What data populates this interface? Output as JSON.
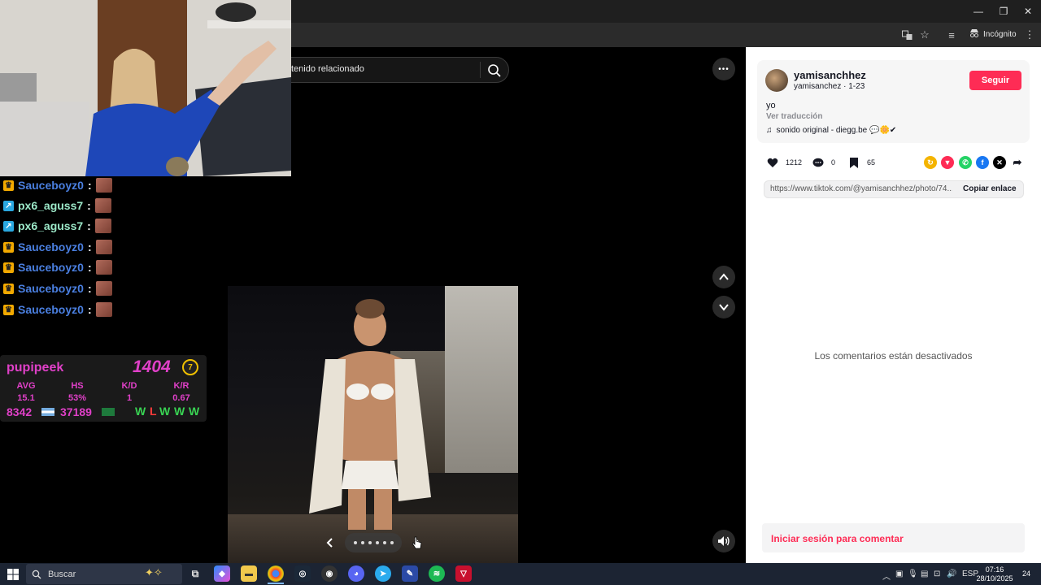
{
  "browser": {
    "incognito_label": "Incógnito",
    "icons": [
      "translate-icon",
      "bookmark-star-icon",
      "reading-list-icon",
      "incognito-icon",
      "browser-menu-icon"
    ],
    "window_controls": [
      "minimize-icon",
      "restore-icon",
      "close-icon"
    ]
  },
  "video": {
    "search_text": "tenido relacionado",
    "more_label": "•••",
    "carousel_dots": 6
  },
  "chat": {
    "lines": [
      {
        "user": "Sauceboyz0",
        "badge": "crown",
        "color": "#4a7fe0"
      },
      {
        "user": "px6_aguss7",
        "badge": "arrow",
        "color": "#9ce8c8"
      },
      {
        "user": "px6_aguss7",
        "badge": "arrow",
        "color": "#9ce8c8"
      },
      {
        "user": "Sauceboyz0",
        "badge": "crown",
        "color": "#4a7fe0"
      },
      {
        "user": "Sauceboyz0",
        "badge": "crown",
        "color": "#4a7fe0"
      },
      {
        "user": "Sauceboyz0",
        "badge": "crown",
        "color": "#4a7fe0"
      },
      {
        "user": "Sauceboyz0",
        "badge": "crown",
        "color": "#4a7fe0"
      }
    ],
    "colon": ":"
  },
  "stats": {
    "name": "pupipeek",
    "elo": "1404",
    "level": "7",
    "headers": [
      "AVG",
      "HS",
      "K/D",
      "K/R"
    ],
    "values": [
      "15.1",
      "53%",
      "1",
      "0.67"
    ],
    "rank_ar": "8342",
    "rank_sa": "37189",
    "results": [
      "W",
      "L",
      "W",
      "W",
      "W"
    ]
  },
  "post": {
    "username": "yamisanchhez",
    "subline": "yamisanchez · 1-23",
    "follow_label": "Seguir",
    "caption": "yo",
    "translate_label": "Ver traducción",
    "sound": "sonido original - diegg.be 💬🌼✔",
    "likes": "1212",
    "comments": "0",
    "saves": "65",
    "link": "https://www.tiktok.com/@yamisanchhez/photo/74...",
    "copy_label": "Copiar enlace",
    "comments_disabled": "Los comentarios están desactivados",
    "login_prompt": "Iniciar sesión para comentar"
  },
  "taskbar": {
    "search_placeholder": "Buscar",
    "tray_lang": "ESP",
    "time": "07:16",
    "date": "28/10/2025",
    "notif_count": "24"
  },
  "colors": {
    "accent": "#fe2c55",
    "stats_magenta": "#e040c8",
    "win_green": "#39d353",
    "loss_red": "#ff3b3b"
  }
}
